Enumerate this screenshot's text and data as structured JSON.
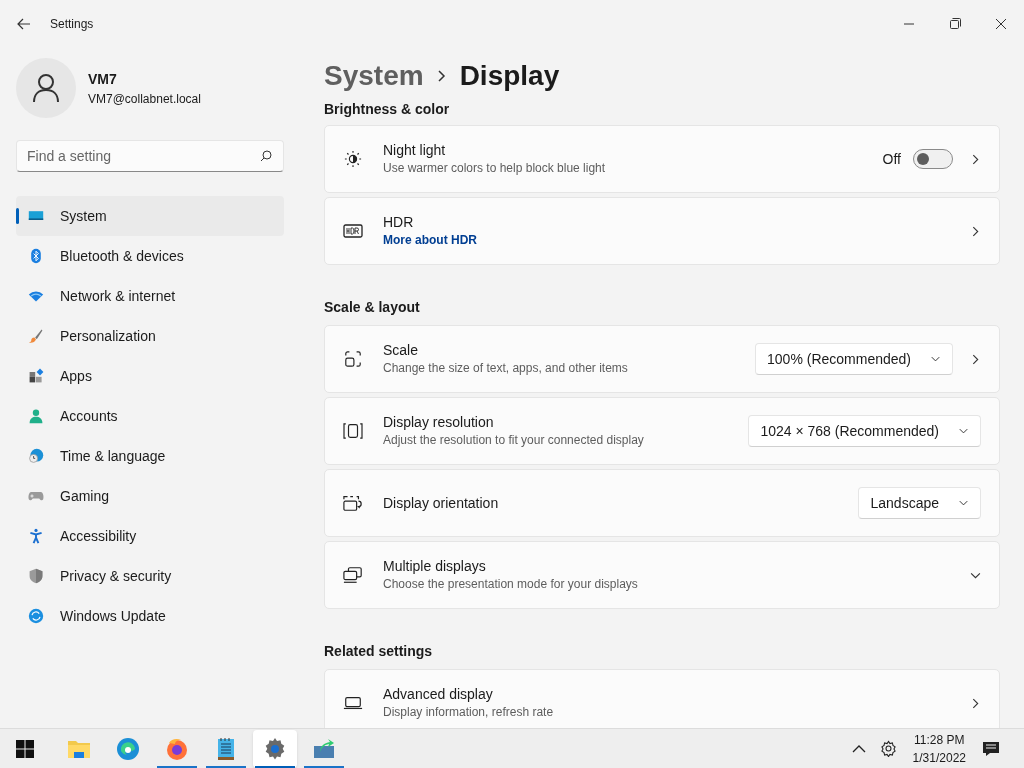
{
  "window": {
    "title": "Settings"
  },
  "user": {
    "name": "VM7",
    "email": "VM7@collabnet.local"
  },
  "search": {
    "placeholder": "Find a setting"
  },
  "nav": [
    {
      "label": "System",
      "selected": true
    },
    {
      "label": "Bluetooth & devices",
      "selected": false
    },
    {
      "label": "Network & internet",
      "selected": false
    },
    {
      "label": "Personalization",
      "selected": false
    },
    {
      "label": "Apps",
      "selected": false
    },
    {
      "label": "Accounts",
      "selected": false
    },
    {
      "label": "Time & language",
      "selected": false
    },
    {
      "label": "Gaming",
      "selected": false
    },
    {
      "label": "Accessibility",
      "selected": false
    },
    {
      "label": "Privacy & security",
      "selected": false
    },
    {
      "label": "Windows Update",
      "selected": false
    }
  ],
  "breadcrumb": {
    "parent": "System",
    "current": "Display"
  },
  "sections": [
    {
      "heading": "Brightness & color",
      "cards": [
        {
          "kind": "nav",
          "title": "Night light",
          "subtitle": "Use warmer colors to help block blue light",
          "toggle": {
            "label": "Off",
            "on": false
          }
        },
        {
          "kind": "nav",
          "title": "HDR",
          "link": "More about HDR"
        }
      ]
    },
    {
      "heading": "Scale & layout",
      "cards": [
        {
          "kind": "nav",
          "title": "Scale",
          "subtitle": "Change the size of text, apps, and other items",
          "dropdown": "100% (Recommended)"
        },
        {
          "kind": "plain",
          "title": "Display resolution",
          "subtitle": "Adjust the resolution to fit your connected display",
          "dropdown": "1024 × 768 (Recommended)"
        },
        {
          "kind": "plain",
          "title": "Display orientation",
          "dropdown": "Landscape"
        },
        {
          "kind": "expander",
          "expanded": false,
          "title": "Multiple displays",
          "subtitle": "Choose the presentation mode for your displays"
        }
      ]
    },
    {
      "heading": "Related settings",
      "cards": [
        {
          "kind": "nav",
          "title": "Advanced display",
          "subtitle": "Display information, refresh rate"
        }
      ]
    }
  ],
  "taskbar": {
    "apps": [
      {
        "running": false,
        "active": false
      },
      {
        "running": false,
        "active": false
      },
      {
        "running": true,
        "active": false
      },
      {
        "running": true,
        "active": false
      },
      {
        "running": true,
        "active": true
      },
      {
        "running": true,
        "active": false
      }
    ],
    "time": "11:28 PM",
    "date": "1/31/2022"
  }
}
